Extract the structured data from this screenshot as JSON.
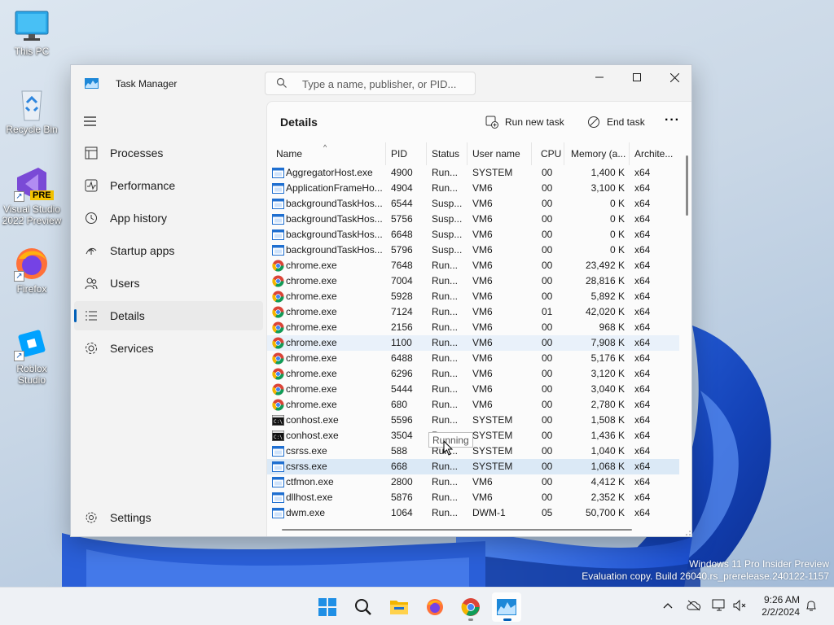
{
  "desktop": {
    "icons": [
      {
        "label": "This PC"
      },
      {
        "label": "Recycle Bin"
      },
      {
        "label": "Visual Studio 2022 Preview"
      },
      {
        "label": "Firefox"
      },
      {
        "label": "Roblox Studio"
      }
    ],
    "vs_badge": "PRE"
  },
  "window": {
    "title": "Task Manager",
    "search_placeholder": "Type a name, publisher, or PID...",
    "nav": [
      {
        "label": "Processes",
        "icon": "processes-icon"
      },
      {
        "label": "Performance",
        "icon": "performance-icon"
      },
      {
        "label": "App history",
        "icon": "app-history-icon"
      },
      {
        "label": "Startup apps",
        "icon": "startup-apps-icon"
      },
      {
        "label": "Users",
        "icon": "users-icon"
      },
      {
        "label": "Details",
        "icon": "details-icon",
        "active": true
      },
      {
        "label": "Services",
        "icon": "services-icon"
      }
    ],
    "settings_label": "Settings",
    "page_title": "Details",
    "toolbar": {
      "run_new_task": "Run new task",
      "end_task": "End task"
    },
    "columns": [
      "Name",
      "PID",
      "Status",
      "User name",
      "CPU",
      "Memory (a...",
      "Archite..."
    ],
    "rows": [
      {
        "icon": "window",
        "name": "AggregatorHost.exe",
        "pid": "4900",
        "status": "Run...",
        "user": "SYSTEM",
        "cpu": "00",
        "mem": "1,400 K",
        "arch": "x64"
      },
      {
        "icon": "window",
        "name": "ApplicationFrameHo...",
        "pid": "4904",
        "status": "Run...",
        "user": "VM6",
        "cpu": "00",
        "mem": "3,100 K",
        "arch": "x64"
      },
      {
        "icon": "window",
        "name": "backgroundTaskHos...",
        "pid": "6544",
        "status": "Susp...",
        "user": "VM6",
        "cpu": "00",
        "mem": "0 K",
        "arch": "x64"
      },
      {
        "icon": "window",
        "name": "backgroundTaskHos...",
        "pid": "5756",
        "status": "Susp...",
        "user": "VM6",
        "cpu": "00",
        "mem": "0 K",
        "arch": "x64"
      },
      {
        "icon": "window",
        "name": "backgroundTaskHos...",
        "pid": "6648",
        "status": "Susp...",
        "user": "VM6",
        "cpu": "00",
        "mem": "0 K",
        "arch": "x64"
      },
      {
        "icon": "window",
        "name": "backgroundTaskHos...",
        "pid": "5796",
        "status": "Susp...",
        "user": "VM6",
        "cpu": "00",
        "mem": "0 K",
        "arch": "x64"
      },
      {
        "icon": "chrome",
        "name": "chrome.exe",
        "pid": "7648",
        "status": "Run...",
        "user": "VM6",
        "cpu": "00",
        "mem": "23,492 K",
        "arch": "x64"
      },
      {
        "icon": "chrome",
        "name": "chrome.exe",
        "pid": "7004",
        "status": "Run...",
        "user": "VM6",
        "cpu": "00",
        "mem": "28,816 K",
        "arch": "x64"
      },
      {
        "icon": "chrome",
        "name": "chrome.exe",
        "pid": "5928",
        "status": "Run...",
        "user": "VM6",
        "cpu": "00",
        "mem": "5,892 K",
        "arch": "x64"
      },
      {
        "icon": "chrome",
        "name": "chrome.exe",
        "pid": "7124",
        "status": "Run...",
        "user": "VM6",
        "cpu": "01",
        "mem": "42,020 K",
        "arch": "x64"
      },
      {
        "icon": "chrome",
        "name": "chrome.exe",
        "pid": "2156",
        "status": "Run...",
        "user": "VM6",
        "cpu": "00",
        "mem": "968 K",
        "arch": "x64"
      },
      {
        "icon": "chrome",
        "name": "chrome.exe",
        "pid": "1100",
        "status": "Run...",
        "user": "VM6",
        "cpu": "00",
        "mem": "7,908 K",
        "arch": "x64",
        "hover": true
      },
      {
        "icon": "chrome",
        "name": "chrome.exe",
        "pid": "6488",
        "status": "Run...",
        "user": "VM6",
        "cpu": "00",
        "mem": "5,176 K",
        "arch": "x64"
      },
      {
        "icon": "chrome",
        "name": "chrome.exe",
        "pid": "6296",
        "status": "Run...",
        "user": "VM6",
        "cpu": "00",
        "mem": "3,120 K",
        "arch": "x64"
      },
      {
        "icon": "chrome",
        "name": "chrome.exe",
        "pid": "5444",
        "status": "Run...",
        "user": "VM6",
        "cpu": "00",
        "mem": "3,040 K",
        "arch": "x64"
      },
      {
        "icon": "chrome",
        "name": "chrome.exe",
        "pid": "680",
        "status": "Run...",
        "user": "VM6",
        "cpu": "00",
        "mem": "2,780 K",
        "arch": "x64"
      },
      {
        "icon": "console",
        "name": "conhost.exe",
        "pid": "5596",
        "status": "Run...",
        "user": "SYSTEM",
        "cpu": "00",
        "mem": "1,508 K",
        "arch": "x64"
      },
      {
        "icon": "console",
        "name": "conhost.exe",
        "pid": "3504",
        "status": "Run...",
        "user": "SYSTEM",
        "cpu": "00",
        "mem": "1,436 K",
        "arch": "x64"
      },
      {
        "icon": "window",
        "name": "csrss.exe",
        "pid": "588",
        "status": "Run...",
        "user": "SYSTEM",
        "cpu": "00",
        "mem": "1,040 K",
        "arch": "x64"
      },
      {
        "icon": "window",
        "name": "csrss.exe",
        "pid": "668",
        "status": "Run...",
        "user": "SYSTEM",
        "cpu": "00",
        "mem": "1,068 K",
        "arch": "x64",
        "selected": true
      },
      {
        "icon": "window",
        "name": "ctfmon.exe",
        "pid": "2800",
        "status": "Run...",
        "user": "VM6",
        "cpu": "00",
        "mem": "4,412 K",
        "arch": "x64"
      },
      {
        "icon": "window",
        "name": "dllhost.exe",
        "pid": "5876",
        "status": "Run...",
        "user": "VM6",
        "cpu": "00",
        "mem": "2,352 K",
        "arch": "x64"
      },
      {
        "icon": "window",
        "name": "dwm.exe",
        "pid": "1064",
        "status": "Run...",
        "user": "DWM-1",
        "cpu": "05",
        "mem": "50,700 K",
        "arch": "x64"
      }
    ],
    "tooltip": "Running"
  },
  "watermark": {
    "line1": "Windows 11 Pro Insider Preview",
    "line2": "Evaluation copy. Build 26040.rs_prerelease.240122-1157"
  },
  "taskbar": {
    "pinned": [
      "start-icon",
      "search-icon",
      "file-explorer-icon",
      "firefox-icon",
      "chrome-icon",
      "task-manager-icon"
    ],
    "clock": {
      "time": "9:26 AM",
      "date": "2/2/2024"
    }
  },
  "colors": {
    "accent": "#005fb8",
    "selection": "#dbe9f6",
    "wallpaper_blue": "#1e54c8"
  }
}
